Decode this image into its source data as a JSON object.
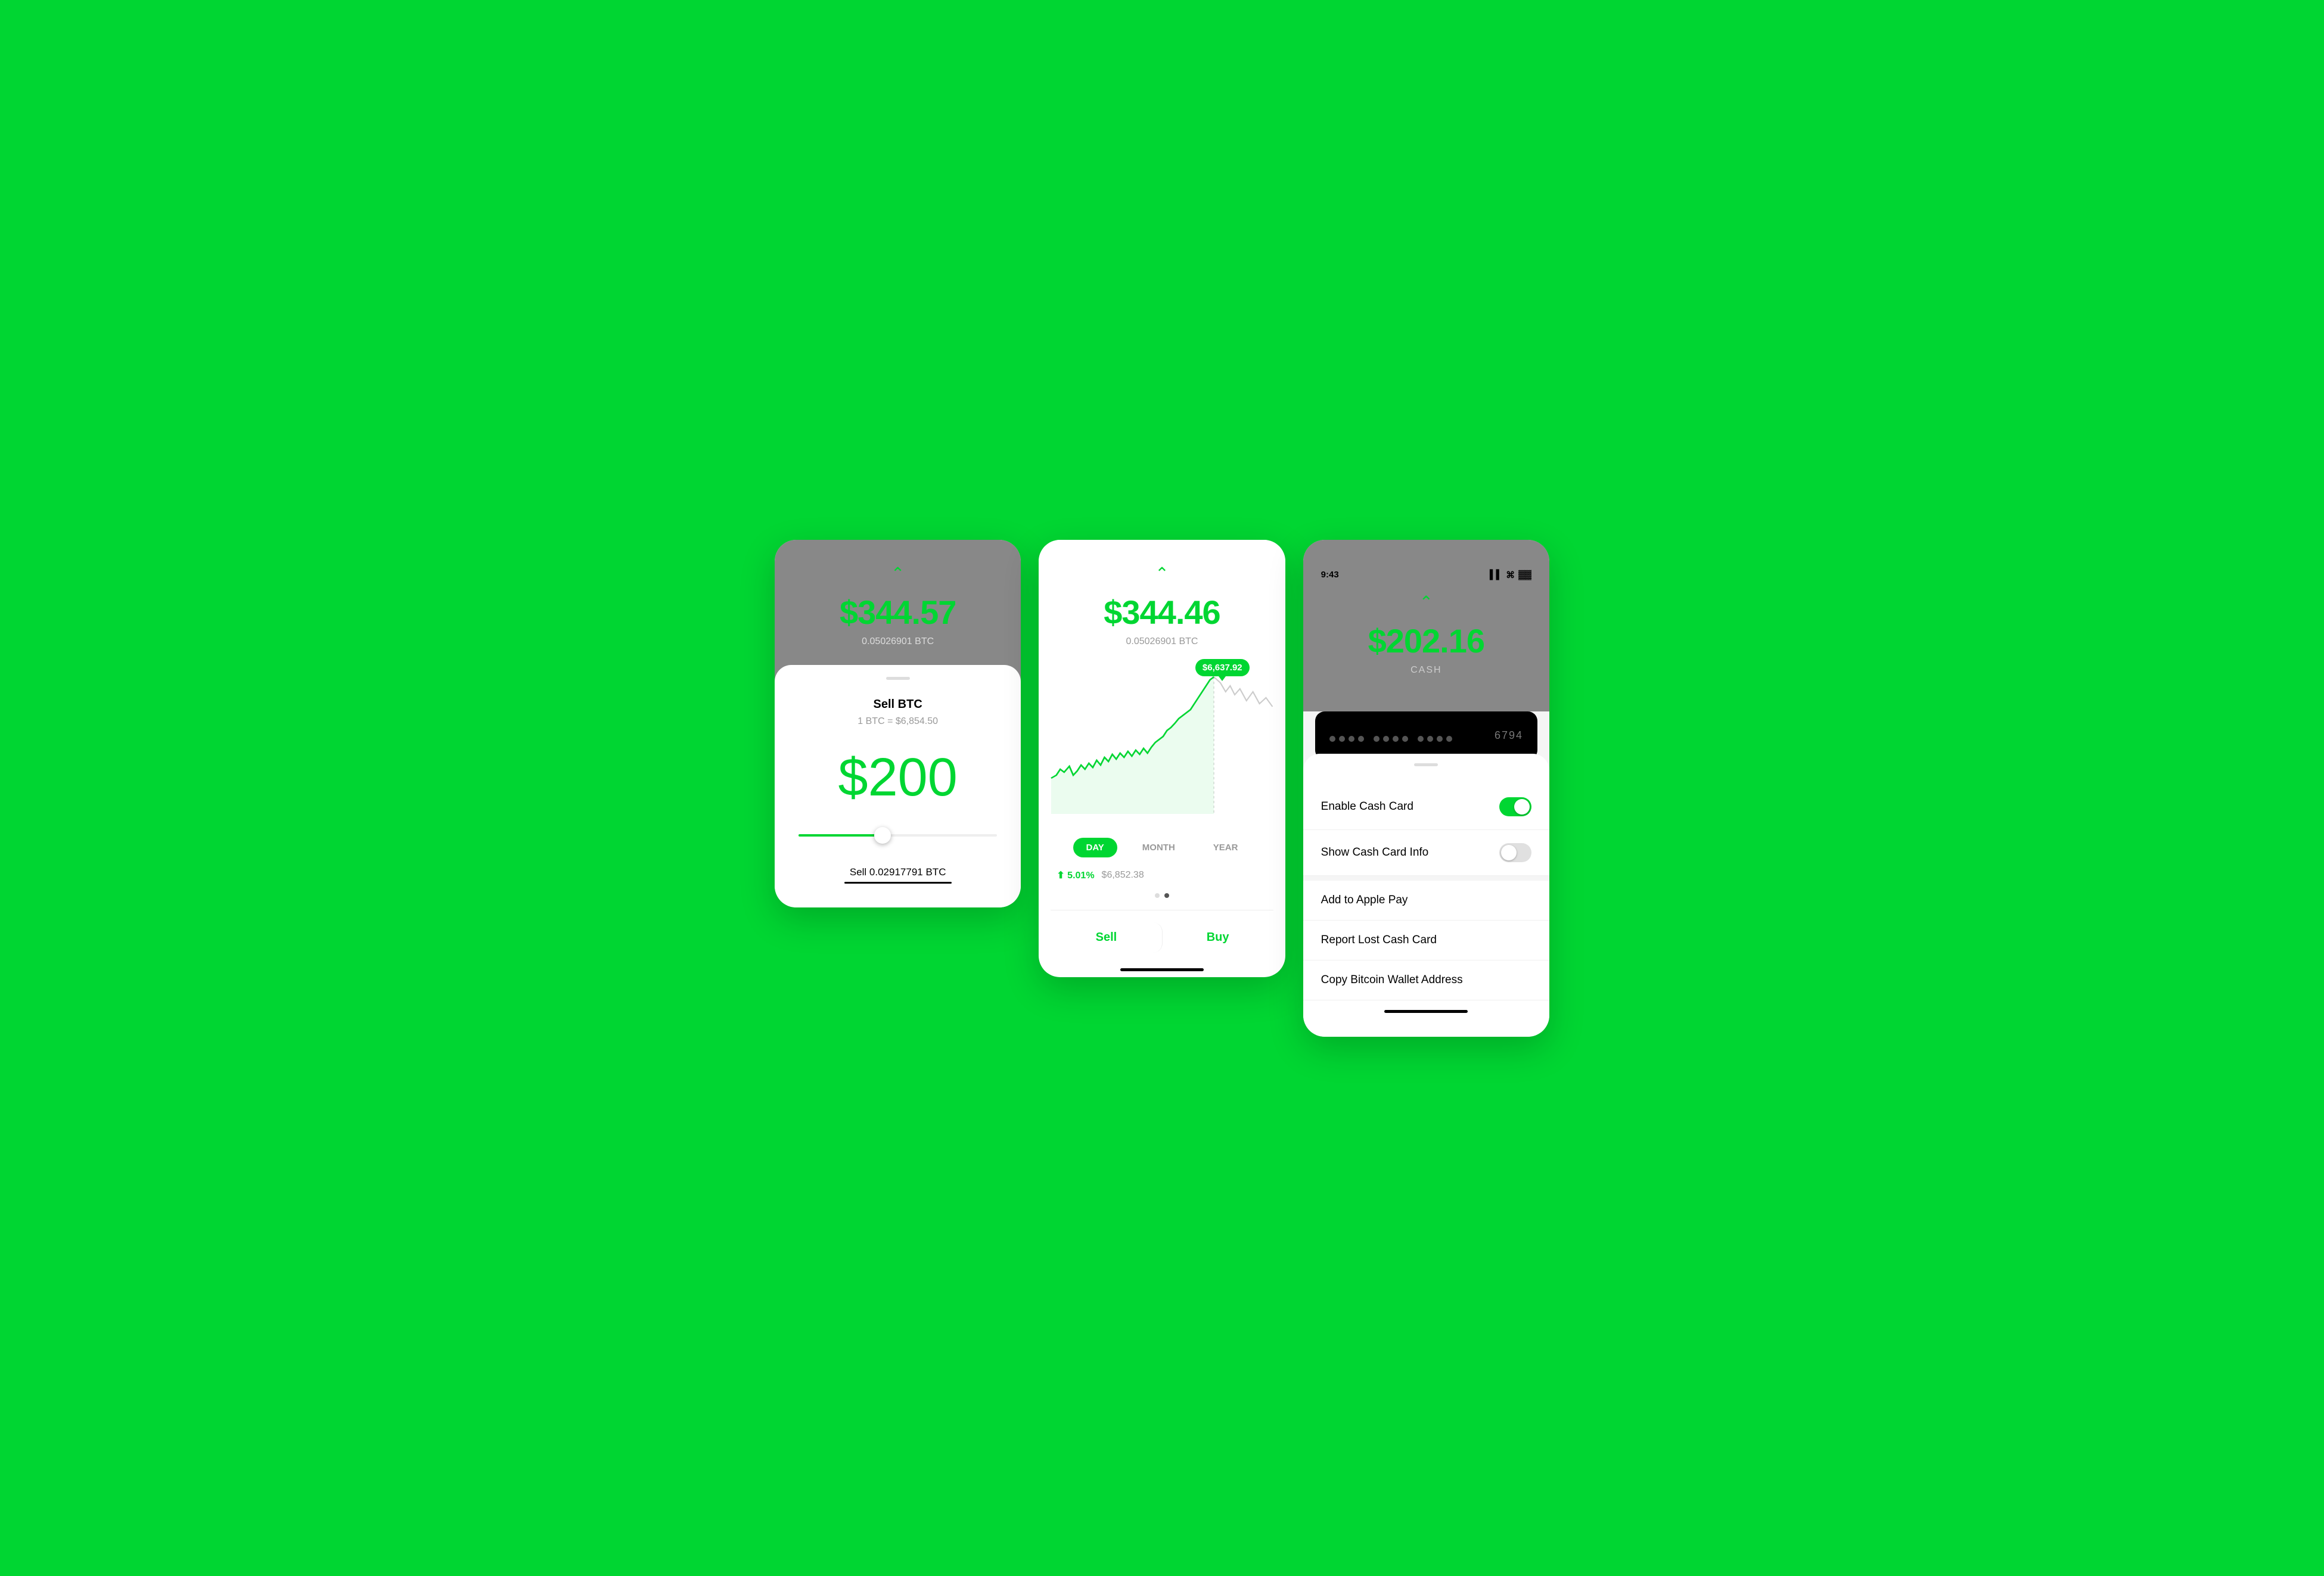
{
  "screen1": {
    "balance": "$344.57",
    "btc_amount": "0.05026901 BTC",
    "sell_title": "Sell BTC",
    "rate": "1 BTC = $6,854.50",
    "amount": "$200",
    "sell_label": "Sell 0.02917791 BTC"
  },
  "screen2": {
    "balance": "$344.46",
    "btc_amount": "0.05026901 BTC",
    "tooltip_price": "$6,637.92",
    "time_tabs": [
      "DAY",
      "MONTH",
      "YEAR"
    ],
    "active_tab": "DAY",
    "change_pct": "⬆ 5.01%",
    "current_price": "$6,852.38",
    "sell_btn": "Sell",
    "buy_btn": "Buy"
  },
  "screen3": {
    "time": "9:43",
    "balance": "$202.16",
    "cash_label": "CASH",
    "card_last4": "6794",
    "menu_items": [
      {
        "label": "Enable Cash Card",
        "type": "toggle",
        "state": "on"
      },
      {
        "label": "Show Cash Card Info",
        "type": "toggle",
        "state": "off"
      },
      {
        "label": "Add to Apple Pay",
        "type": "text"
      },
      {
        "label": "Report Lost Cash Card",
        "type": "text"
      },
      {
        "label": "Copy Bitcoin Wallet Address",
        "type": "text"
      }
    ]
  },
  "colors": {
    "green": "#00D632",
    "dark_gray": "#888",
    "light_gray": "#f5f5f5"
  }
}
